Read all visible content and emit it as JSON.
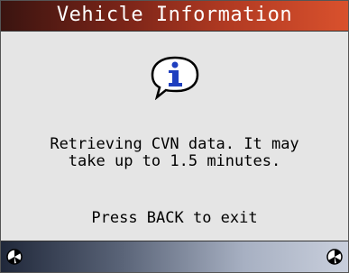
{
  "header": {
    "title": "Vehicle Information"
  },
  "dialog": {
    "icon": "info-speech-bubble-icon",
    "message_line1": "Retrieving CVN data. It may",
    "message_line2": "take up to 1.5 minutes.",
    "instruction": "Press BACK to exit"
  },
  "status_bar": {
    "left_icon": "connection-status-icon",
    "right_icon": "connection-status-icon"
  },
  "colors": {
    "title_bar_start": "#3a1410",
    "title_bar_end": "#d9512d",
    "status_bar_start": "#20283a",
    "status_bar_end": "#c9cfdc",
    "info_icon": "#1f3fbf"
  }
}
